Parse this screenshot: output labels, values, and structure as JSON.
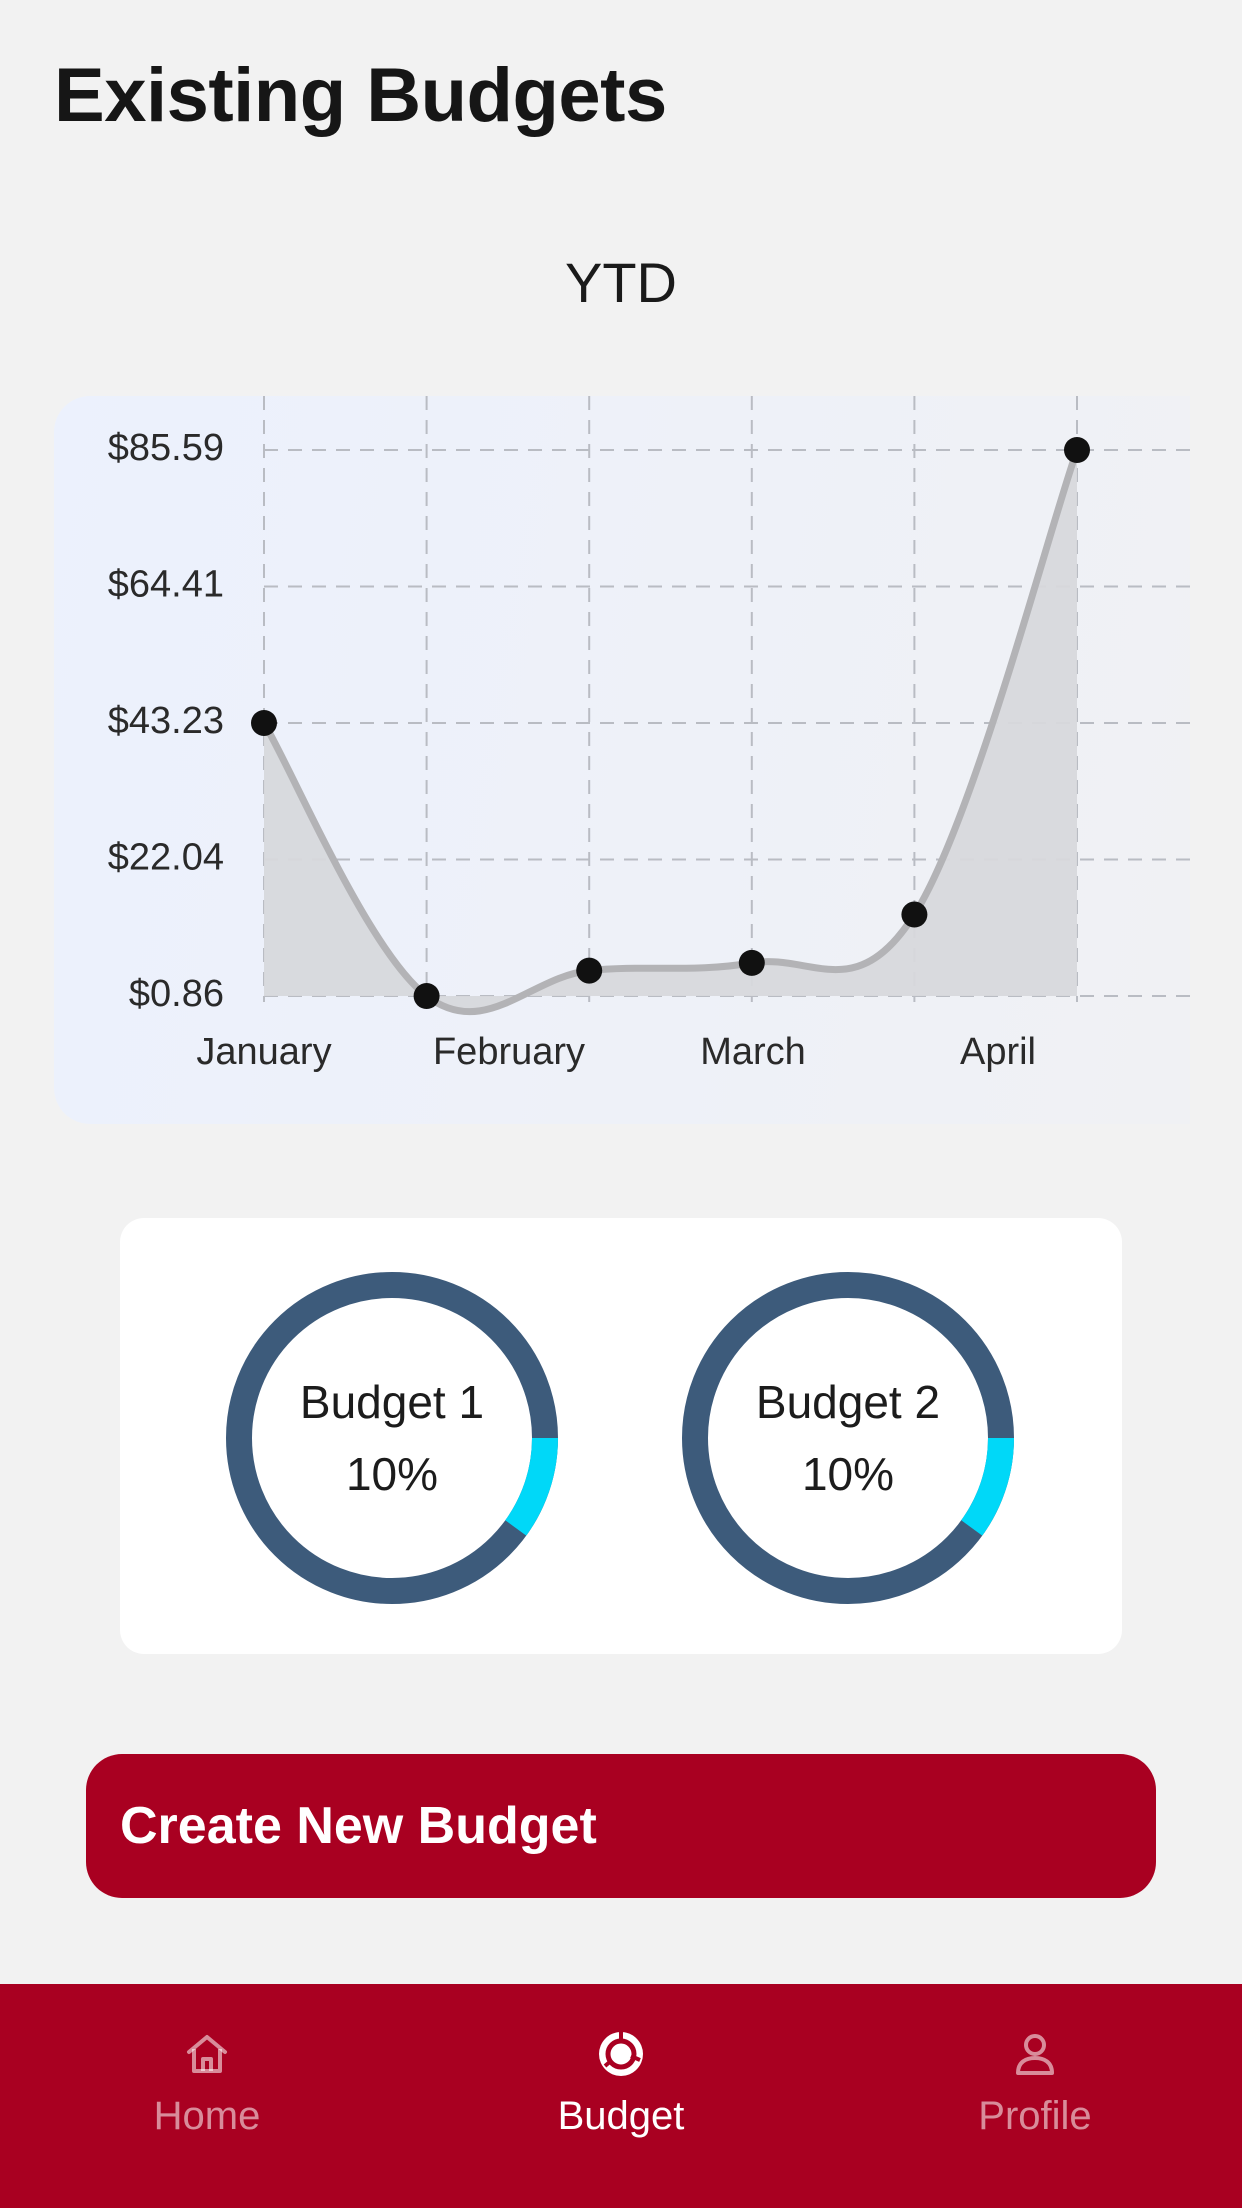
{
  "page": {
    "title": "Existing Budgets"
  },
  "chart_data": {
    "type": "area",
    "title": "YTD",
    "categories": [
      "January",
      "February",
      "March",
      "April"
    ],
    "x": [
      1,
      2,
      3,
      4,
      5,
      6
    ],
    "values": [
      43.23,
      0.86,
      4.8,
      6.0,
      13.5,
      85.59
    ],
    "y_ticks": [
      "$0.86",
      "$22.04",
      "$43.23",
      "$64.41",
      "$85.59"
    ],
    "y_tick_values": [
      0.86,
      22.04,
      43.23,
      64.41,
      85.59
    ],
    "ylim": [
      0.86,
      85.59
    ],
    "grid": true,
    "line_color": "#b3b3b6",
    "fill_color": "#d7d8dc",
    "point_color": "#111111"
  },
  "budgets": [
    {
      "label": "Budget 1",
      "percent_label": "10%",
      "percent": 10
    },
    {
      "label": "Budget 2",
      "percent_label": "10%",
      "percent": 10
    }
  ],
  "ring_colors": {
    "track": "#3d5b7b",
    "progress": "#00d8f8",
    "inner": "#ffffff"
  },
  "actions": {
    "create_label": "Create New Budget"
  },
  "tabs": [
    {
      "label": "Home",
      "icon": "home-icon",
      "active": false
    },
    {
      "label": "Budget",
      "icon": "budget-icon",
      "active": true
    },
    {
      "label": "Profile",
      "icon": "profile-icon",
      "active": false
    }
  ],
  "colors": {
    "brand": "#a90021",
    "background": "#f2f2f2"
  }
}
